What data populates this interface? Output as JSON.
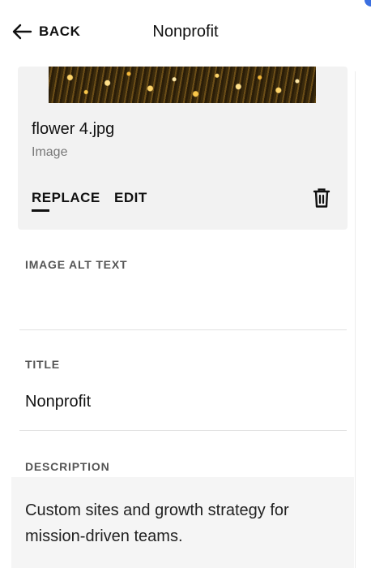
{
  "header": {
    "back_label": "BACK",
    "title": "Nonprofit"
  },
  "image_card": {
    "file_name": "flower 4.jpg",
    "file_type": "Image",
    "actions": {
      "replace": "REPLACE",
      "edit": "EDIT"
    },
    "icons": {
      "back": "arrow-left-icon",
      "delete": "trash-icon"
    }
  },
  "fields": {
    "alt_text": {
      "label": "IMAGE ALT TEXT",
      "value": ""
    },
    "title": {
      "label": "TITLE",
      "value": "Nonprofit"
    },
    "description": {
      "label": "DESCRIPTION",
      "value": "Custom sites and growth strategy for mission-driven teams."
    }
  },
  "colors": {
    "text": "#111111",
    "muted": "#777777",
    "label": "#555555",
    "card_bg": "#f2f2f2",
    "desc_bg": "#f5f5f5",
    "accent": "#3b6fe0"
  }
}
